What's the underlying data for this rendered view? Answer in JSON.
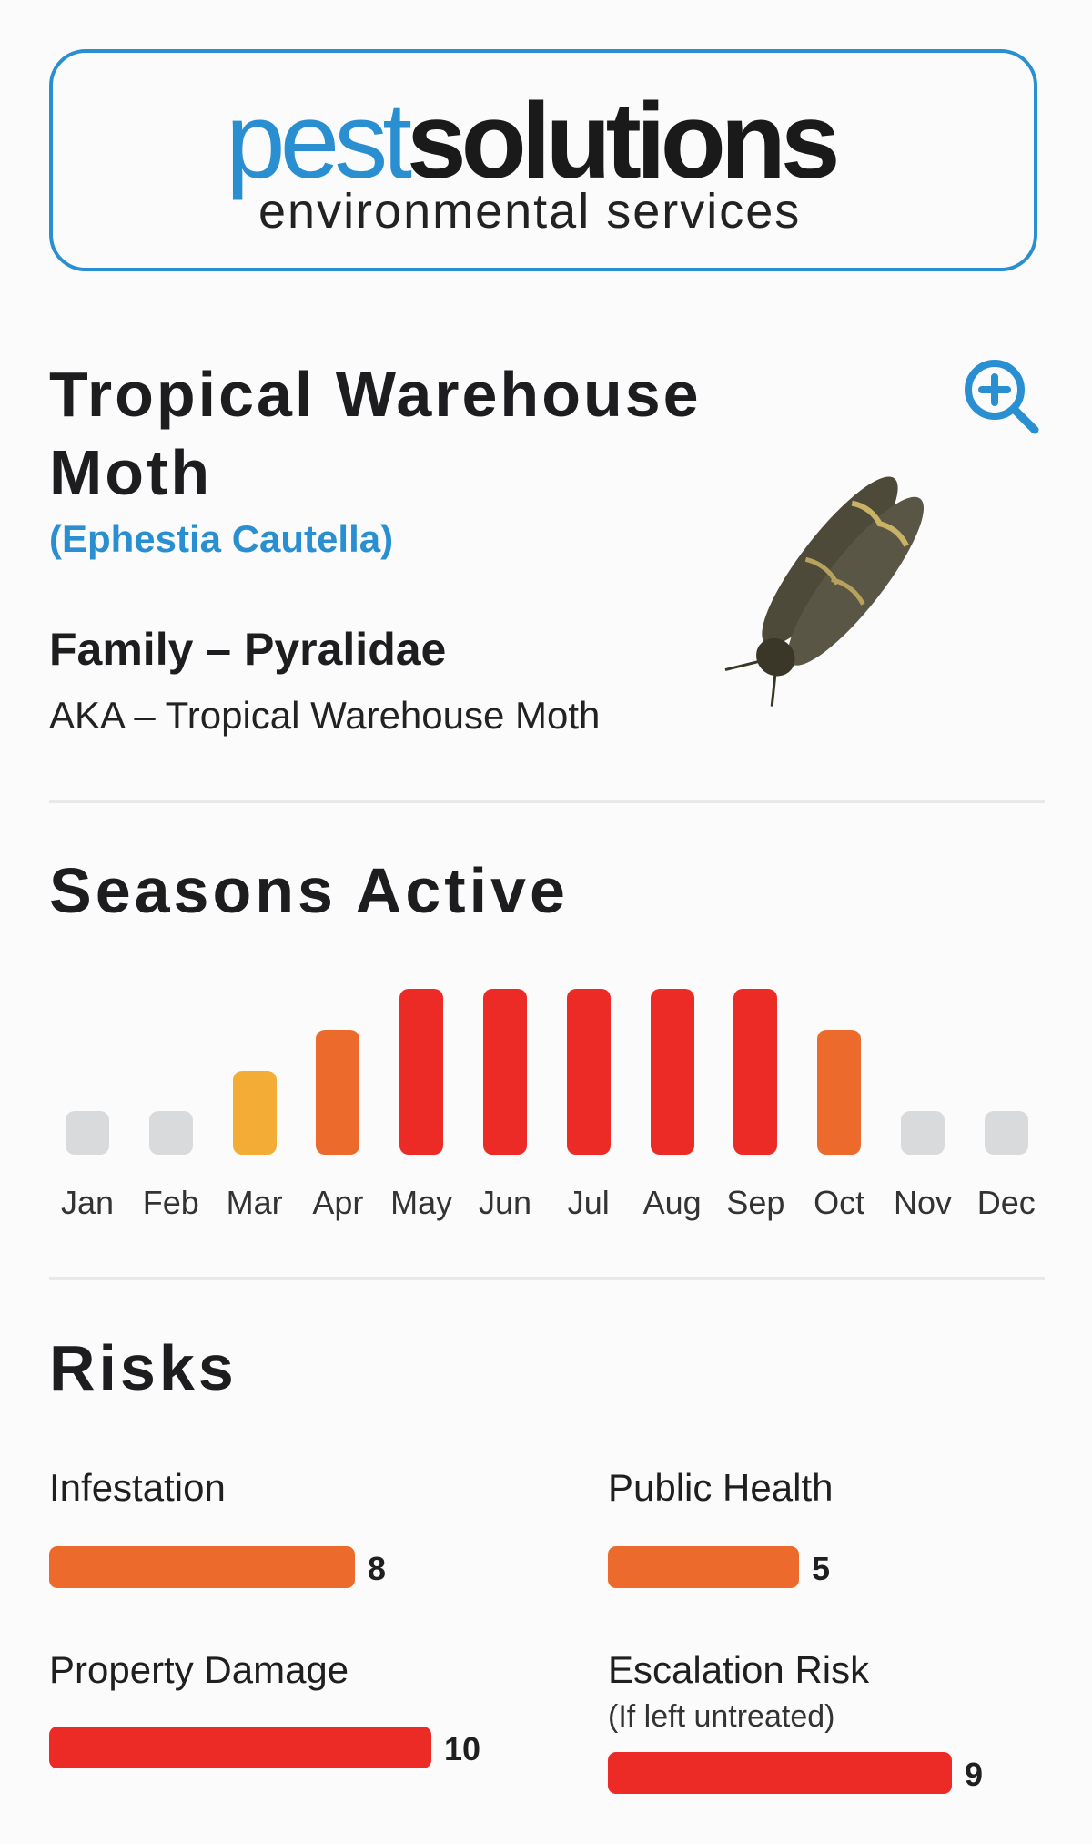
{
  "brand": {
    "name_part1": "pest",
    "name_part2": "solutions",
    "tagline": "environmental services",
    "primary_color": "#2a8fd1"
  },
  "pest": {
    "title": "Tropical Warehouse Moth",
    "latin_name": "(Ephestia Cautella)",
    "family": "Family – Pyralidae",
    "aka": "AKA – Tropical Warehouse Moth",
    "zoom_icon": "zoom-in-icon",
    "image_icon": "moth-icon"
  },
  "seasons": {
    "heading": "Seasons Active",
    "months": [
      {
        "label": "Jan",
        "level": 0
      },
      {
        "label": "Feb",
        "level": 0
      },
      {
        "label": "Mar",
        "level": 1
      },
      {
        "label": "Apr",
        "level": 2
      },
      {
        "label": "May",
        "level": 3
      },
      {
        "label": "Jun",
        "level": 3
      },
      {
        "label": "Jul",
        "level": 3
      },
      {
        "label": "Aug",
        "level": 3
      },
      {
        "label": "Sep",
        "level": 3
      },
      {
        "label": "Oct",
        "level": 2
      },
      {
        "label": "Nov",
        "level": 0
      },
      {
        "label": "Dec",
        "level": 0
      }
    ],
    "level_colors": [
      "#d9dadc",
      "#f3ad36",
      "#ec6a2b",
      "#ec2a26"
    ]
  },
  "risks": {
    "heading": "Risks",
    "max": 10,
    "items": [
      {
        "label": "Infestation",
        "value": 8,
        "color": "#ec6a2b"
      },
      {
        "label": "Public Health",
        "value": 5,
        "color": "#ec6a2b"
      },
      {
        "label": "Property Damage",
        "value": 10,
        "color": "#ec2a26"
      },
      {
        "label": "Escalation Risk",
        "sublabel": "(If left untreated)",
        "value": 9,
        "color": "#ec2a26"
      }
    ]
  }
}
